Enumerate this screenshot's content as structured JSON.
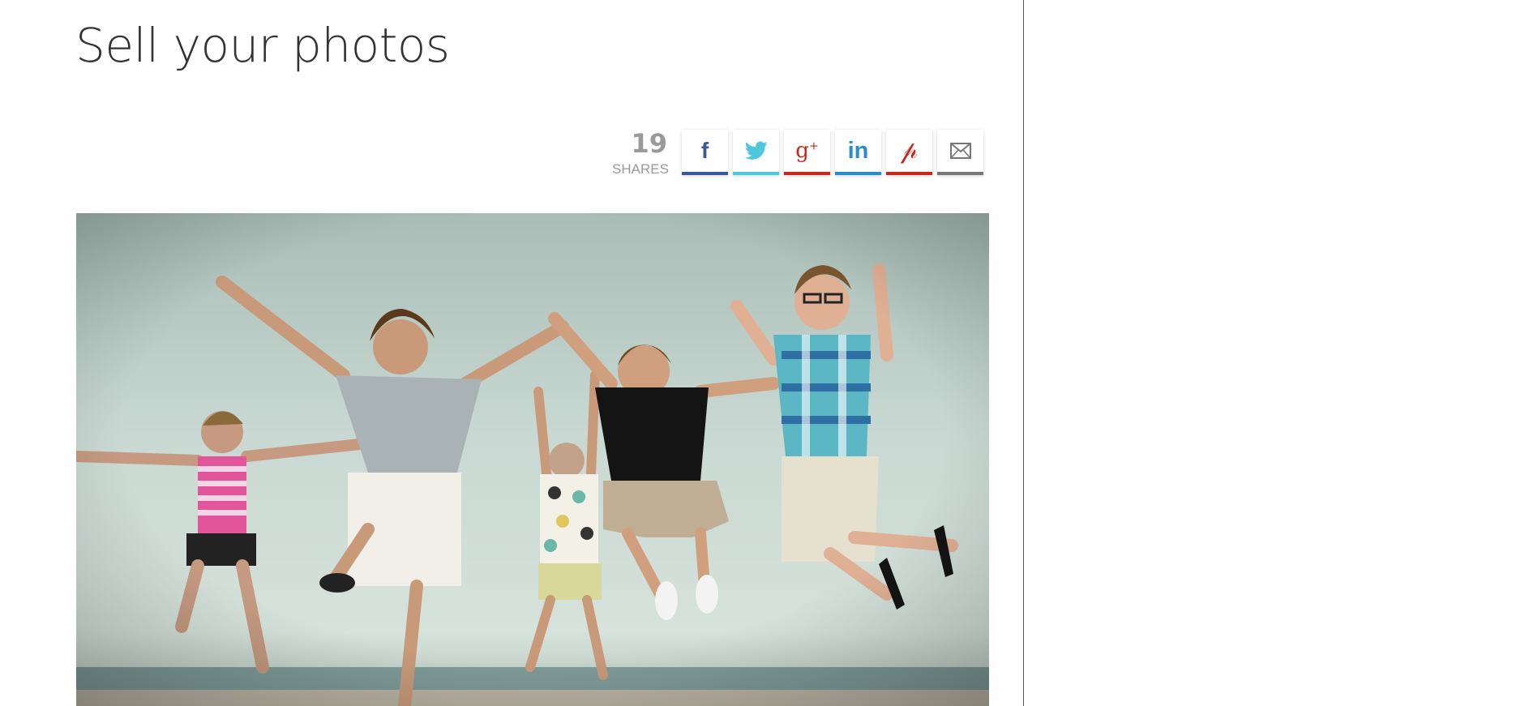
{
  "page": {
    "title": "Sell your photos"
  },
  "share": {
    "count": "19",
    "count_label": "SHARES",
    "buttons": [
      {
        "network": "facebook",
        "icon": "facebook-icon",
        "color": "#3b5998"
      },
      {
        "network": "twitter",
        "icon": "twitter-icon",
        "color": "#4ec8dd"
      },
      {
        "network": "google-plus",
        "icon": "google-plus-icon",
        "color": "#c8281b"
      },
      {
        "network": "linkedin",
        "icon": "linkedin-icon",
        "color": "#2a8cc8"
      },
      {
        "network": "pinterest",
        "icon": "pinterest-icon",
        "color": "#c8281b"
      },
      {
        "network": "email",
        "icon": "email-icon",
        "color": "#777777"
      }
    ]
  },
  "colors": {
    "title_text": "#333333",
    "share_count": "#9a9a9a",
    "divider": "#555555"
  }
}
